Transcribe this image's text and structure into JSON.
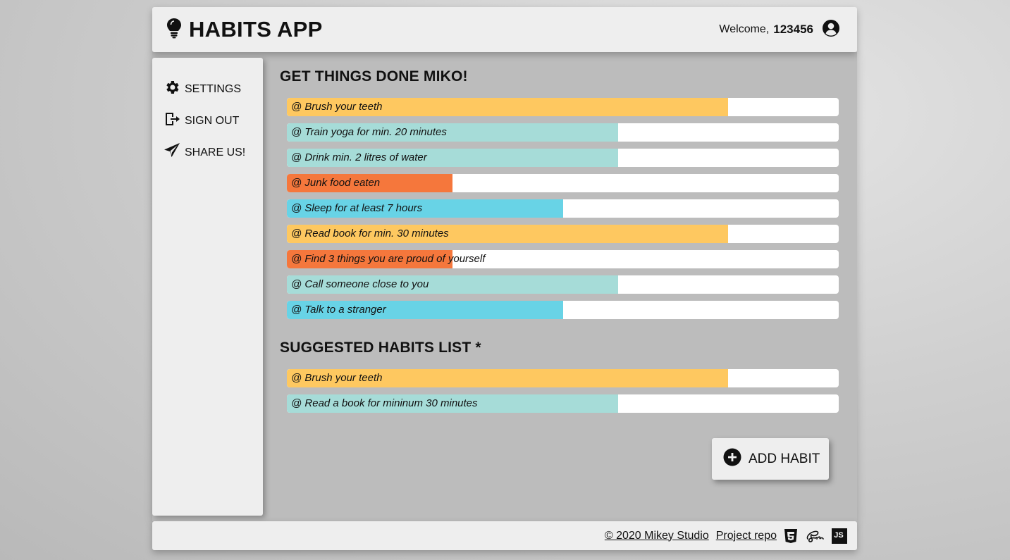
{
  "colors": {
    "yellow": "#fec860",
    "teal": "#a6dcd8",
    "orange": "#f5773c",
    "cyan": "#68d3e6"
  },
  "header": {
    "title": "HABITS APP",
    "welcome_text": "Welcome,",
    "username": "123456",
    "logo_icon": "lightbulb-icon",
    "user_icon": "user-circle-icon"
  },
  "sidebar": {
    "items": [
      {
        "label": "SETTINGS",
        "icon": "gear-icon"
      },
      {
        "label": "SIGN OUT",
        "icon": "sign-out-icon"
      },
      {
        "label": "SHARE US!",
        "icon": "paper-plane-icon"
      }
    ]
  },
  "main": {
    "title": "GET THINGS DONE MIKO!",
    "habits": [
      {
        "label": "@ Brush your teeth",
        "progress": 0.8,
        "color": "yellow"
      },
      {
        "label": "@ Train yoga for min. 20 minutes",
        "progress": 0.6,
        "color": "teal"
      },
      {
        "label": "@ Drink min. 2 litres of water",
        "progress": 0.6,
        "color": "teal"
      },
      {
        "label": "@ Junk food eaten",
        "progress": 0.3,
        "color": "orange"
      },
      {
        "label": "@ Sleep for at least 7 hours",
        "progress": 0.5,
        "color": "cyan"
      },
      {
        "label": "@ Read book for min. 30 minutes",
        "progress": 0.8,
        "color": "yellow"
      },
      {
        "label": "@ Find 3 things you are proud of yourself",
        "progress": 0.3,
        "color": "orange"
      },
      {
        "label": "@ Call someone close to you",
        "progress": 0.6,
        "color": "teal"
      },
      {
        "label": "@ Talk to a stranger",
        "progress": 0.5,
        "color": "cyan"
      }
    ]
  },
  "suggested": {
    "title": "SUGGESTED HABITS LIST *",
    "habits": [
      {
        "label": "@ Brush your teeth",
        "progress": 0.8,
        "color": "yellow"
      },
      {
        "label": "@ Read a book for mininum 30 minutes",
        "progress": 0.6,
        "color": "teal"
      }
    ]
  },
  "add_button": {
    "label": "ADD HABIT",
    "icon": "plus-circle-icon"
  },
  "footer": {
    "copyright": "© 2020 Mikey Studio",
    "repo_link": "Project repo",
    "icons": [
      "html5-icon",
      "sass-icon",
      "javascript-icon"
    ],
    "js_badge": "JS"
  }
}
